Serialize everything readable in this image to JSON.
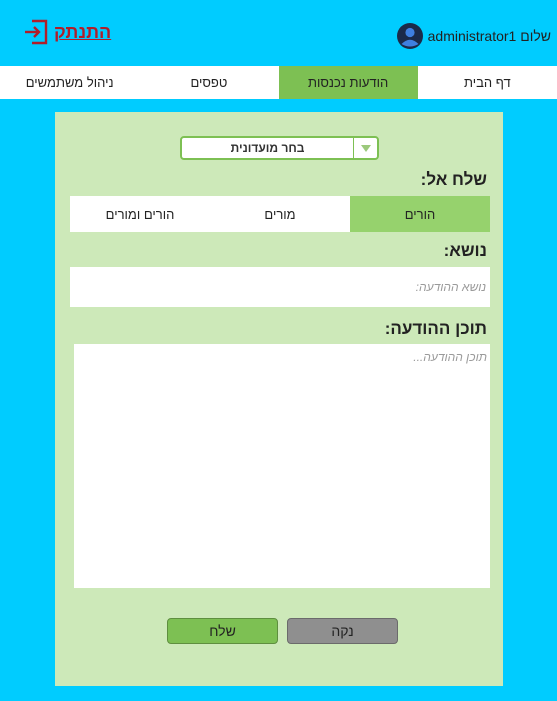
{
  "header": {
    "greeting": "שלום",
    "username": "administrator1",
    "logout_label": "התנתק"
  },
  "nav": {
    "items": [
      {
        "label": "דף הבית",
        "active": false
      },
      {
        "label": "הודעות נכנסות",
        "active": true
      },
      {
        "label": "טפסים",
        "active": false
      },
      {
        "label": "ניהול משתמשים",
        "active": false
      }
    ]
  },
  "form": {
    "committee_select": {
      "value": "בחר מועדונית"
    },
    "send_to_label": "שלח אל:",
    "recipients": [
      {
        "label": "הורים",
        "active": true
      },
      {
        "label": "מורים",
        "active": false
      },
      {
        "label": "הורים ומורים",
        "active": false
      }
    ],
    "subject_label": "נושא:",
    "subject_placeholder": "נושא ההודעה:",
    "content_label": "תוכן ההודעה:",
    "content_placeholder": "תוכן ההודעה...",
    "clear_label": "נקה",
    "send_label": "שלח"
  },
  "colors": {
    "background": "#00ccff",
    "accent_green": "#7dc053",
    "panel_green": "#cde9b9",
    "logout_red": "#b01e2a"
  }
}
